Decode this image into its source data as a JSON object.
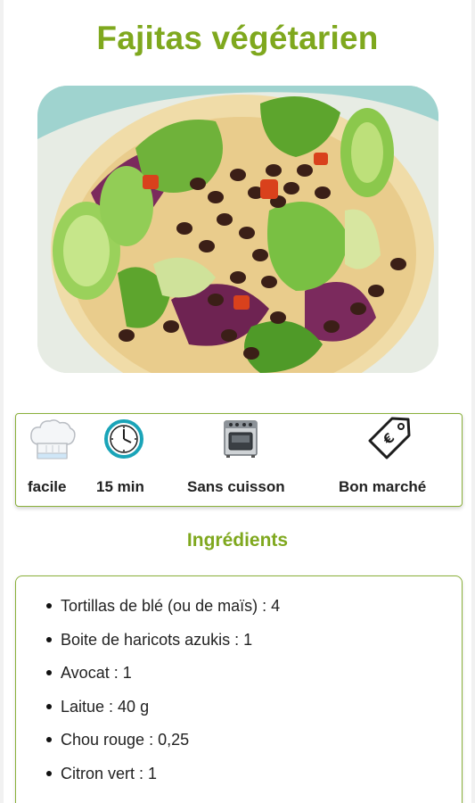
{
  "recipe": {
    "title": "Fajitas végétarien",
    "photo_icon": "fajita-photo"
  },
  "info": {
    "difficulty": {
      "icon": "chef-hat-icon",
      "label": "facile"
    },
    "time": {
      "icon": "clock-icon",
      "label": "15 min"
    },
    "cooking": {
      "icon": "oven-icon",
      "label": "Sans cuisson"
    },
    "cost": {
      "icon": "price-tag-icon",
      "label": "Bon marché"
    }
  },
  "ingredients": {
    "title": "Ingrédients",
    "items": [
      "Tortillas de blé (ou de maïs) : 4",
      "Boite de haricots azukis : 1",
      "Avocat : 1",
      "Laitue : 40 g",
      "Chou rouge : 0,25",
      "Citron vert : 1"
    ]
  },
  "colors": {
    "accent": "#7fa81e",
    "border": "#8ab03a",
    "clock": "#1aa4b8"
  }
}
